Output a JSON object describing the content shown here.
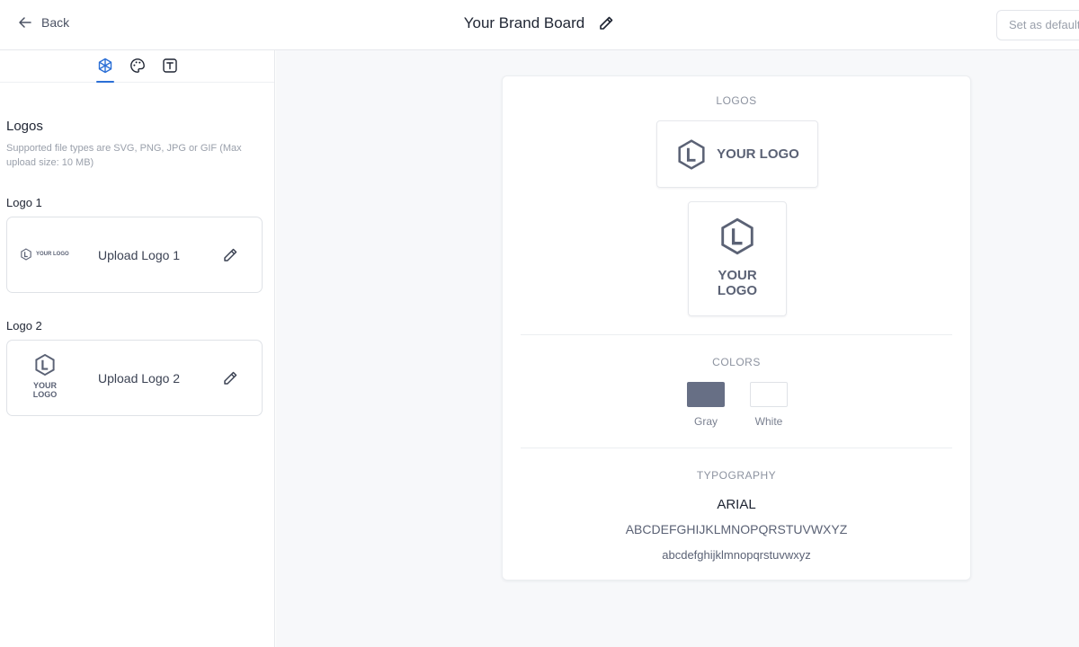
{
  "header": {
    "back_label": "Back",
    "title": "Your Brand Board",
    "set_default_label": "Set as default"
  },
  "sidebar": {
    "tabs": [
      {
        "icon": "logo-cube-icon",
        "active": true
      },
      {
        "icon": "palette-icon",
        "active": false
      },
      {
        "icon": "typography-icon",
        "active": false
      }
    ],
    "section_title": "Logos",
    "section_desc": "Supported file types are SVG, PNG, JPG or GIF (Max upload size: 10 MB)",
    "logos": [
      {
        "label": "Logo 1",
        "upload_text": "Upload Logo 1",
        "thumb_text": "YOUR LOGO"
      },
      {
        "label": "Logo 2",
        "upload_text": "Upload Logo 2",
        "thumb_line1": "YOUR",
        "thumb_line2": "LOGO"
      }
    ]
  },
  "board": {
    "logos_heading": "LOGOS",
    "logo_h_text": "YOUR LOGO",
    "logo_v_line1": "YOUR",
    "logo_v_line2": "LOGO",
    "hex_letter": "L",
    "colors_heading": "COLORS",
    "colors": [
      {
        "name": "Gray",
        "hex": "#676f85"
      },
      {
        "name": "White",
        "hex": "#ffffff"
      }
    ],
    "typography_heading": "TYPOGRAPHY",
    "font_name": "ARIAL",
    "uppercase_sample": "ABCDEFGHIJKLMNOPQRSTUVWXYZ",
    "lowercase_sample": "abcdefghijklmnopqrstuvwxyz"
  },
  "colors": {
    "accent": "#2b6fd6",
    "logo_gray": "#5b6275"
  }
}
